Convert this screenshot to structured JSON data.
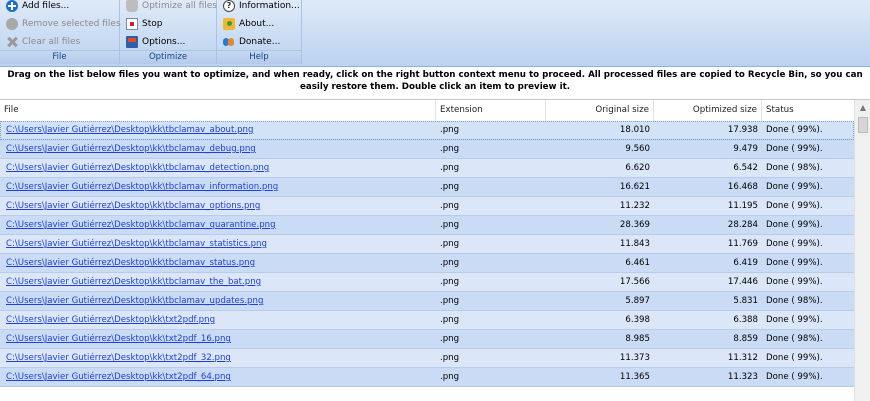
{
  "ribbon": {
    "file": {
      "title": "File",
      "add_files": "Add files...",
      "remove_selected": "Remove selected files",
      "clear_all": "Clear all files"
    },
    "optimize": {
      "title": "Optimize",
      "optimize_all": "Optimize all files",
      "stop": "Stop",
      "options": "Options..."
    },
    "help": {
      "title": "Help",
      "information": "Information...",
      "about": "About...",
      "donate": "Donate..."
    }
  },
  "instructions": "Drag on the list below files you want to optimize, and when ready, click on the right button context menu to proceed. All processed files are copied to Recycle Bin, so you can easily restore them. Double click an item to preview it.",
  "columns": {
    "file": "File",
    "extension": "Extension",
    "original_size": "Original size",
    "optimized_size": "Optimized size",
    "status": "Status"
  },
  "rows": [
    {
      "file": "C:\\Users\\Javier Gutiérrez\\Desktop\\kk\\tbclamav_about.png",
      "ext": ".png",
      "orig": "18.010",
      "opt": "17.938",
      "status": "Done ( 99%)."
    },
    {
      "file": "C:\\Users\\Javier Gutiérrez\\Desktop\\kk\\tbclamav_debug.png",
      "ext": ".png",
      "orig": "9.560",
      "opt": "9.479",
      "status": "Done ( 99%)."
    },
    {
      "file": "C:\\Users\\Javier Gutiérrez\\Desktop\\kk\\tbclamav_detection.png",
      "ext": ".png",
      "orig": "6.620",
      "opt": "6.542",
      "status": "Done ( 98%)."
    },
    {
      "file": "C:\\Users\\Javier Gutiérrez\\Desktop\\kk\\tbclamav_information.png",
      "ext": ".png",
      "orig": "16.621",
      "opt": "16.468",
      "status": "Done ( 99%)."
    },
    {
      "file": "C:\\Users\\Javier Gutiérrez\\Desktop\\kk\\tbclamav_options.png",
      "ext": ".png",
      "orig": "11.232",
      "opt": "11.195",
      "status": "Done ( 99%)."
    },
    {
      "file": "C:\\Users\\Javier Gutiérrez\\Desktop\\kk\\tbclamav_quarantine.png",
      "ext": ".png",
      "orig": "28.369",
      "opt": "28.284",
      "status": "Done ( 99%)."
    },
    {
      "file": "C:\\Users\\Javier Gutiérrez\\Desktop\\kk\\tbclamav_statistics.png",
      "ext": ".png",
      "orig": "11.843",
      "opt": "11.769",
      "status": "Done ( 99%)."
    },
    {
      "file": "C:\\Users\\Javier Gutiérrez\\Desktop\\kk\\tbclamav_status.png",
      "ext": ".png",
      "orig": "6.461",
      "opt": "6.419",
      "status": "Done ( 99%)."
    },
    {
      "file": "C:\\Users\\Javier Gutiérrez\\Desktop\\kk\\tbclamav_the_bat.png",
      "ext": ".png",
      "orig": "17.566",
      "opt": "17.446",
      "status": "Done ( 99%)."
    },
    {
      "file": "C:\\Users\\Javier Gutiérrez\\Desktop\\kk\\tbclamav_updates.png",
      "ext": ".png",
      "orig": "5.897",
      "opt": "5.831",
      "status": "Done ( 98%)."
    },
    {
      "file": "C:\\Users\\Javier Gutiérrez\\Desktop\\kk\\txt2pdf.png",
      "ext": ".png",
      "orig": "6.398",
      "opt": "6.388",
      "status": "Done ( 99%)."
    },
    {
      "file": "C:\\Users\\Javier Gutiérrez\\Desktop\\kk\\txt2pdf_16.png",
      "ext": ".png",
      "orig": "8.985",
      "opt": "8.859",
      "status": "Done ( 98%)."
    },
    {
      "file": "C:\\Users\\Javier Gutiérrez\\Desktop\\kk\\txt2pdf_32.png",
      "ext": ".png",
      "orig": "11.373",
      "opt": "11.312",
      "status": "Done ( 99%)."
    },
    {
      "file": "C:\\Users\\Javier Gutiérrez\\Desktop\\kk\\txt2pdf_64.png",
      "ext": ".png",
      "orig": "11.365",
      "opt": "11.323",
      "status": "Done ( 99%)."
    }
  ]
}
